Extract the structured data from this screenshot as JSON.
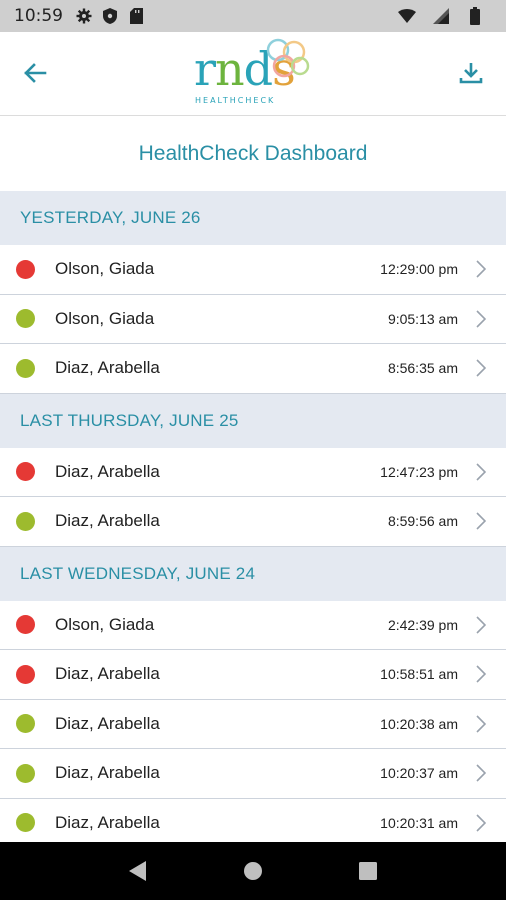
{
  "status_bar": {
    "time": "10:59",
    "icons_left": [
      "gear-icon",
      "shield-icon",
      "sd-card-icon"
    ],
    "icons_right": [
      "wifi-icon",
      "signal-icon",
      "battery-icon"
    ]
  },
  "header": {
    "back_icon": "back-arrow-icon",
    "download_icon": "download-icon",
    "logo_text": "rnds",
    "logo_subtext": "HEALTHCHECK"
  },
  "page": {
    "title": "HealthCheck Dashboard"
  },
  "colors": {
    "red": "#e53935",
    "green": "#9dbb2e",
    "accent": "#2a8fa5"
  },
  "sections": [
    {
      "header": "YESTERDAY, JUNE 26",
      "entries": [
        {
          "status": "red",
          "name": "Olson, Giada",
          "time": "12:29:00 pm"
        },
        {
          "status": "green",
          "name": "Olson, Giada",
          "time": "9:05:13 am"
        },
        {
          "status": "green",
          "name": "Diaz, Arabella",
          "time": "8:56:35 am"
        }
      ]
    },
    {
      "header": "LAST THURSDAY, JUNE 25",
      "entries": [
        {
          "status": "red",
          "name": "Diaz, Arabella",
          "time": "12:47:23 pm"
        },
        {
          "status": "green",
          "name": "Diaz, Arabella",
          "time": "8:59:56 am"
        }
      ]
    },
    {
      "header": "LAST WEDNESDAY, JUNE 24",
      "entries": [
        {
          "status": "red",
          "name": "Olson, Giada",
          "time": "2:42:39 pm"
        },
        {
          "status": "red",
          "name": "Diaz, Arabella",
          "time": "10:58:51 am"
        },
        {
          "status": "green",
          "name": "Diaz, Arabella",
          "time": "10:20:38 am"
        },
        {
          "status": "green",
          "name": "Diaz, Arabella",
          "time": "10:20:37 am"
        },
        {
          "status": "green",
          "name": "Diaz, Arabella",
          "time": "10:20:31 am"
        }
      ]
    }
  ],
  "nav_bar": {
    "icons": [
      "back-triangle-icon",
      "home-circle-icon",
      "recents-square-icon"
    ]
  }
}
